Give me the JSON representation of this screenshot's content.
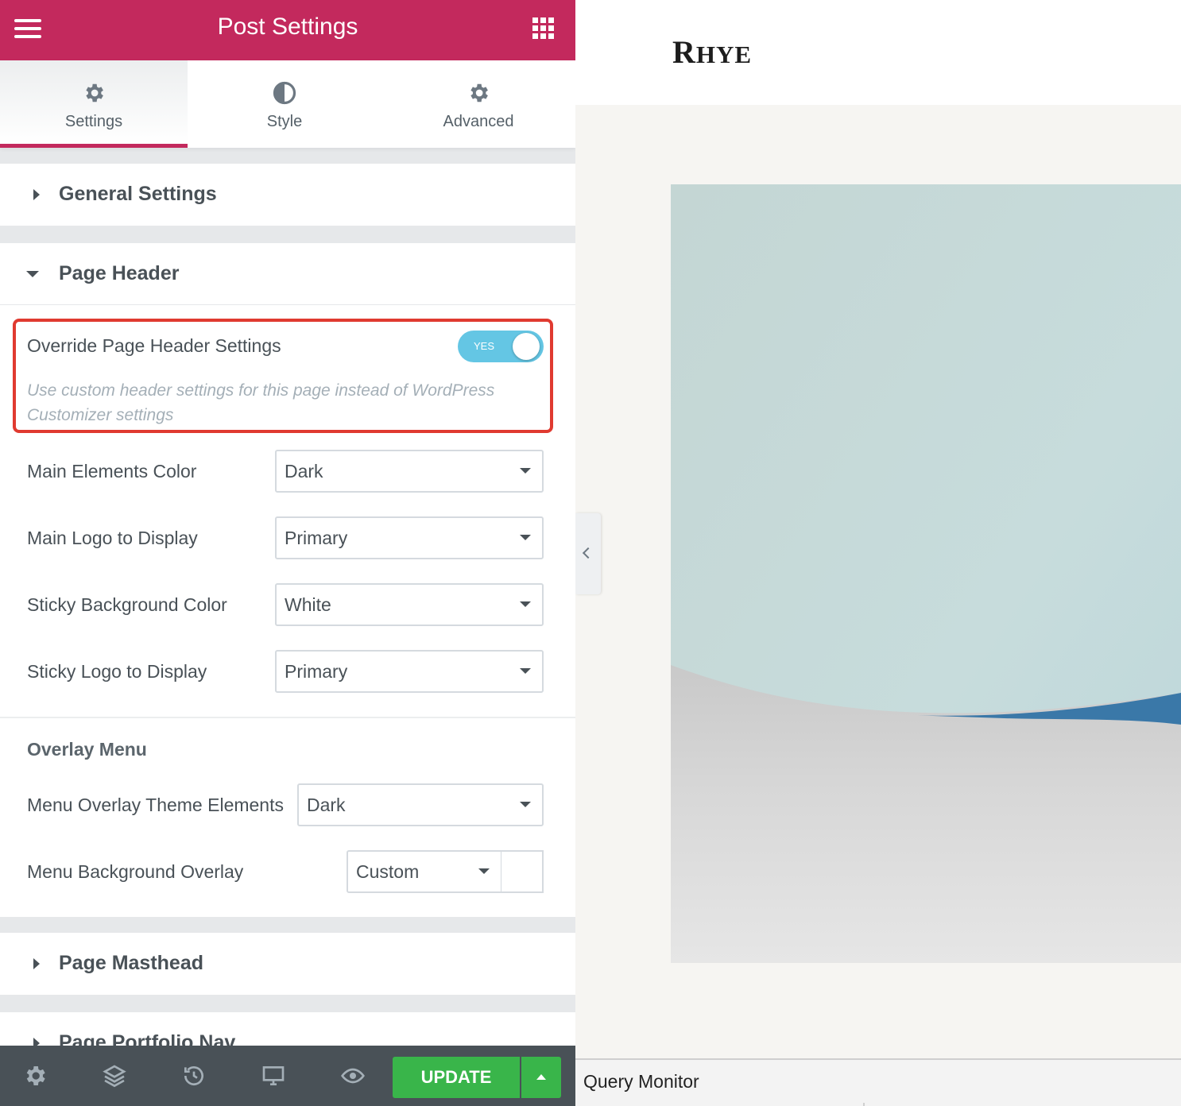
{
  "header": {
    "title": "Post Settings"
  },
  "tabs": [
    {
      "label": "Settings",
      "icon": "gear-icon",
      "active": true
    },
    {
      "label": "Style",
      "icon": "half-circle-icon",
      "active": false
    },
    {
      "label": "Advanced",
      "icon": "gear-icon",
      "active": false
    }
  ],
  "sections": {
    "general": "General Settings",
    "page_header": "Page Header",
    "page_masthead": "Page Masthead",
    "page_portfolio_nav": "Page Portfolio Nav"
  },
  "override": {
    "label": "Override Page Header Settings",
    "toggle_text": "YES",
    "toggle_on": true,
    "description": "Use custom header settings for this page instead of WordPress Customizer settings"
  },
  "controls": [
    {
      "label": "Main Elements Color",
      "value": "Dark"
    },
    {
      "label": "Main Logo to Display",
      "value": "Primary"
    },
    {
      "label": "Sticky Background Color",
      "value": "White"
    },
    {
      "label": "Sticky Logo to Display",
      "value": "Primary"
    }
  ],
  "overlay_menu": {
    "title": "Overlay Menu",
    "theme_elements": {
      "label": "Menu Overlay Theme Elements",
      "value": "Dark"
    },
    "background_overlay": {
      "label": "Menu Background Overlay",
      "value": "Custom"
    }
  },
  "footer": {
    "update_label": "UPDATE",
    "icons": [
      "gear-icon",
      "layers-icon",
      "history-icon",
      "desktop-icon",
      "eye-icon"
    ]
  },
  "preview": {
    "logo_first": "R",
    "logo_rest": "HYE",
    "query_monitor": "Query Monitor"
  },
  "colors": {
    "brand": "#c3295d",
    "toggle": "#64c6e4",
    "update": "#39b54a",
    "highlight": "#e03a30",
    "footer": "#495157"
  }
}
